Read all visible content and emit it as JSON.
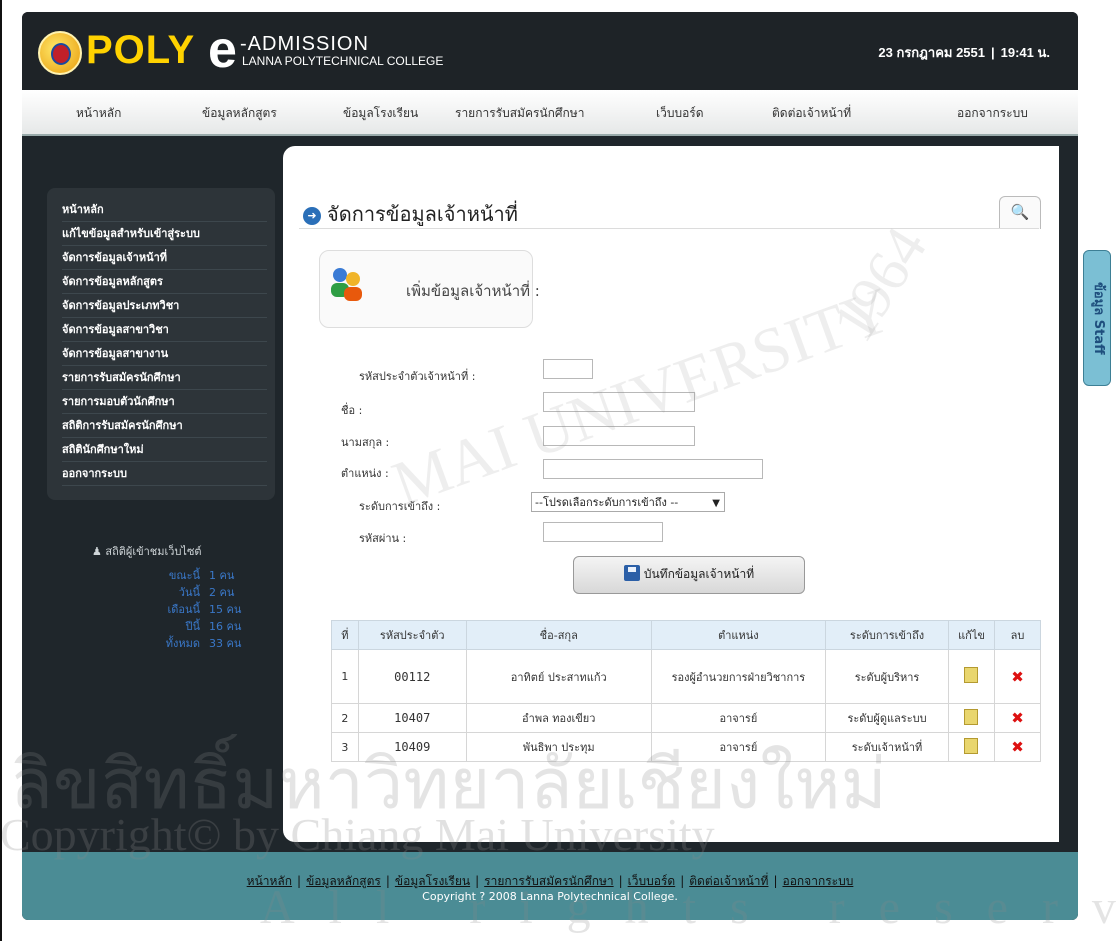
{
  "header": {
    "brand_poly": "POLY",
    "brand_e": "e",
    "brand_admission": "-ADMISSION",
    "brand_subtitle": "LANNA POLYTECHNICAL COLLEGE",
    "date": "23 กรกฎาคม 2551",
    "separator": "|",
    "time": "19:41 น."
  },
  "nav": {
    "items": [
      "หน้าหลัก",
      "ข้อมูลหลักสูตร",
      "ข้อมูลโรงเรียน",
      "รายการรับสมัครนักศึกษา",
      "เว็บบอร์ด",
      "ติดต่อเจ้าหน้าที่",
      "ออกจากระบบ"
    ]
  },
  "sidebar": {
    "items": [
      "หน้าหลัก",
      "แก้ไขข้อมูลสำหรับเข้าสู่ระบบ",
      "จัดการข้อมูลเจ้าหน้าที่",
      "จัดการข้อมูลหลักสูตร",
      "จัดการข้อมูลประเภทวิชา",
      "จัดการข้อมูลสาขาวิชา",
      "จัดการข้อมูลสาขางาน",
      "รายการรับสมัครนักศึกษา",
      "รายการมอบตัวนักศึกษา",
      "สถิติการรับสมัครนักศึกษา",
      "สถิตินักศึกษาใหม่",
      "ออกจากระบบ"
    ]
  },
  "stats": {
    "title": "สถิติผู้เข้าชมเว็บไซต์",
    "rows": [
      {
        "label": "ขณะนี้",
        "value": "1 คน"
      },
      {
        "label": "วันนี้",
        "value": "2 คน"
      },
      {
        "label": "เดือนนี้",
        "value": "15 คน"
      },
      {
        "label": "ปีนี้",
        "value": "16 คน"
      },
      {
        "label": "ทั้งหมด",
        "value": "33 คน"
      }
    ]
  },
  "main": {
    "title": "จัดการข้อมูลเจ้าหน้าที่",
    "subtitle": "เพิ่มข้อมูลเจ้าหน้าที่ :",
    "form": {
      "id_label": "รหัสประจำตัวเจ้าหน้าที่ :",
      "first_name_label": "ชื่อ :",
      "last_name_label": "นามสกุล :",
      "position_label": "ตำแหน่ง :",
      "access_label": "ระดับการเข้าถึง :",
      "access_select": "--โปรดเลือกระดับการเข้าถึง --",
      "password_label": "รหัสผ่าน :",
      "save_button": "บันทึกข้อมูลเจ้าหน้าที่"
    },
    "table": {
      "headers": [
        "ที่",
        "รหัสประจำตัว",
        "ชื่อ-สกุล",
        "ตำแหน่ง",
        "ระดับการเข้าถึง",
        "แก้ไข",
        "ลบ"
      ],
      "rows": [
        {
          "no": "1",
          "id": "00112",
          "name": "อาทิตย์ ประสาทแก้ว",
          "position": "รองผู้อำนวยการฝ่ายวิชาการ",
          "access": "ระดับผู้บริหาร"
        },
        {
          "no": "2",
          "id": "10407",
          "name": "อำพล ทองเขียว",
          "position": "อาจารย์",
          "access": "ระดับผู้ดูแลระบบ"
        },
        {
          "no": "3",
          "id": "10409",
          "name": "พันธิพา ประทุม",
          "position": "อาจารย์",
          "access": "ระดับเจ้าหน้าที่"
        }
      ]
    }
  },
  "footer": {
    "links": [
      "หน้าหลัก",
      "ข้อมูลหลักสูตร",
      "ข้อมูลโรงเรียน",
      "รายการรับสมัครนักศึกษา",
      "เว็บบอร์ด",
      "ติดต่อเจ้าหน้าที่",
      "ออกจากระบบ"
    ],
    "copyright": "Copyright ? 2008 Lanna Polytechnical College."
  },
  "side_tab": "ข้อมูล Staff",
  "watermark": {
    "line1": "ลิขสิทธิ์มหาวิทยาลัยเชียงใหม่",
    "line2": "Copyright© by Chiang Mai University",
    "line3": "All rights reserved",
    "arc1": "MAI UNIVERSITY",
    "arc2": "1964"
  }
}
